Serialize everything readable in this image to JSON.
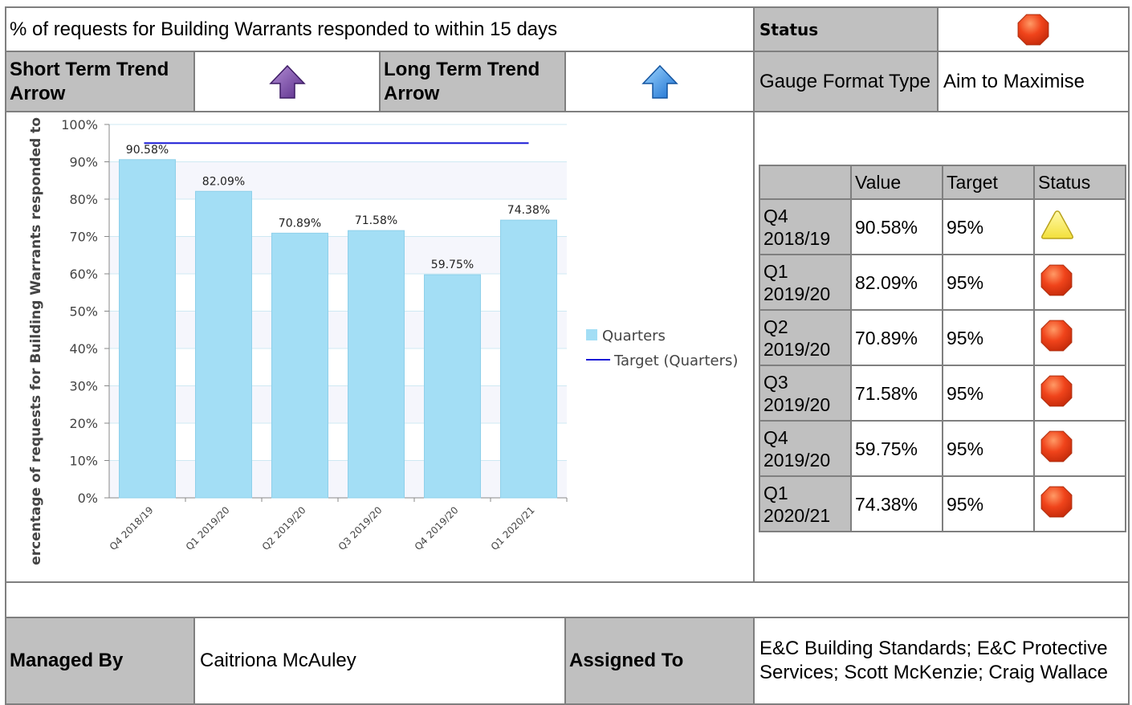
{
  "header": {
    "title": "% of requests for Building Warrants responded to within 15 days",
    "status_label": "Status",
    "status_icon": "red-octagon-icon"
  },
  "trend": {
    "short_label": "Short Term Trend Arrow",
    "short_icon": "purple-up-arrow-icon",
    "long_label": "Long Term Trend Arrow",
    "long_icon": "blue-up-arrow-icon",
    "gauge_label": "Gauge Format Type",
    "gauge_value": "Aim to Maximise"
  },
  "table": {
    "headers": [
      "",
      "Value",
      "Target",
      "Status"
    ],
    "rows": [
      {
        "quarter": "Q4 2018/19",
        "value": "90.58%",
        "target": "95%",
        "status": "warning"
      },
      {
        "quarter": "Q1 2019/20",
        "value": "82.09%",
        "target": "95%",
        "status": "alert"
      },
      {
        "quarter": "Q2 2019/20",
        "value": "70.89%",
        "target": "95%",
        "status": "alert"
      },
      {
        "quarter": "Q3 2019/20",
        "value": "71.58%",
        "target": "95%",
        "status": "alert"
      },
      {
        "quarter": "Q4 2019/20",
        "value": "59.75%",
        "target": "95%",
        "status": "alert"
      },
      {
        "quarter": "Q1 2020/21",
        "value": "74.38%",
        "target": "95%",
        "status": "alert"
      }
    ]
  },
  "footer": {
    "managed_label": "Managed By",
    "managed_value": "Caitriona McAuley",
    "assigned_label": "Assigned To",
    "assigned_value": "E&C Building Standards; E&C Protective Services; Scott McKenzie; Craig Wallace"
  },
  "colors": {
    "bar": "#a3def5",
    "target_line": "#1a1ad6",
    "alert": "#f0441b",
    "warning": "#f3e03a",
    "header_bg": "#c0c0c0"
  },
  "chart_data": {
    "type": "bar",
    "categories": [
      "Q4 2018/19",
      "Q1 2019/20",
      "Q2 2019/20",
      "Q3 2019/20",
      "Q4 2019/20",
      "Q1 2020/21"
    ],
    "series": [
      {
        "name": "Quarters",
        "type": "bar",
        "values": [
          90.58,
          82.09,
          70.89,
          71.58,
          59.75,
          74.38
        ]
      },
      {
        "name": "Target (Quarters)",
        "type": "line",
        "values": [
          95,
          95,
          95,
          95,
          95,
          95
        ]
      }
    ],
    "data_labels": [
      "90.58%",
      "82.09%",
      "70.89%",
      "71.58%",
      "59.75%",
      "74.38%"
    ],
    "y_ticks": [
      "0%",
      "10%",
      "20%",
      "30%",
      "40%",
      "50%",
      "60%",
      "70%",
      "80%",
      "90%",
      "100%"
    ],
    "ylabel": "ercentage of requests for Building Warrants responded to",
    "xlabel": "",
    "ylim": [
      0,
      100
    ],
    "grid": true,
    "legend": "right"
  }
}
